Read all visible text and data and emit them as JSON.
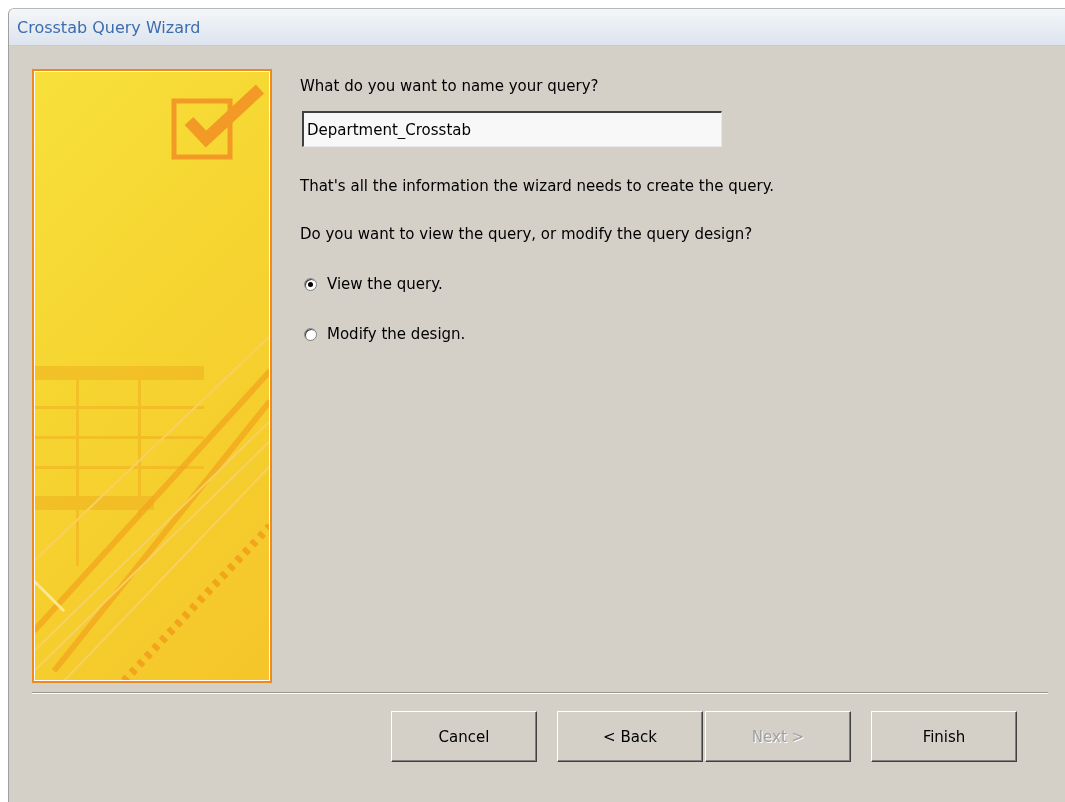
{
  "window": {
    "title": "Crosstab Query Wizard"
  },
  "prompt": "What do you want to name your query?",
  "query_name": {
    "value": "Department_Crosstab"
  },
  "info_text": "That's all the information the wizard needs to create the query.",
  "question": "Do you want to view the query, or modify the query design?",
  "options": [
    {
      "label": "View the query.",
      "selected": true
    },
    {
      "label": "Modify the design.",
      "selected": false
    }
  ],
  "buttons": [
    {
      "label": "Cancel",
      "disabled": false
    },
    {
      "label": "< Back",
      "disabled": false
    },
    {
      "label": "Next >",
      "disabled": true
    },
    {
      "label": "Finish",
      "disabled": false
    }
  ]
}
